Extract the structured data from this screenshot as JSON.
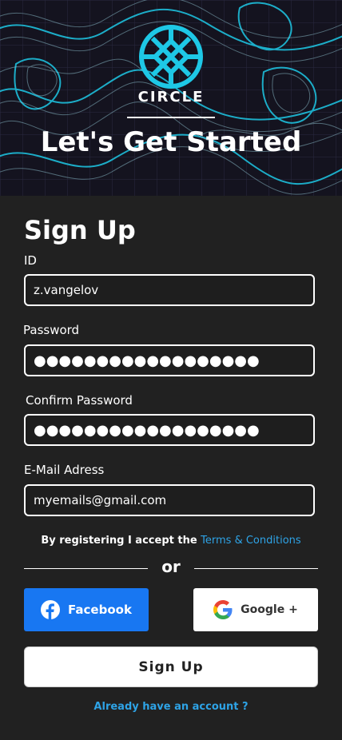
{
  "header": {
    "brand": "CIRCLE",
    "headline": "Let's Get Started"
  },
  "form": {
    "title": "Sign Up",
    "id_label": "ID",
    "id_value": "z.vangelov",
    "password_label": "Password",
    "password_value": "●●●●●●●●●●●●●●●●●●",
    "confirm_label": "Confirm Password",
    "confirm_value": "●●●●●●●●●●●●●●●●●●",
    "email_label": "E-Mail Adress",
    "email_value": "myemails@gmail.com"
  },
  "terms": {
    "prefix": "By registering I accept the ",
    "link": "Terms & Conditions"
  },
  "divider": {
    "text": "or"
  },
  "social": {
    "facebook_label": "Facebook",
    "google_label": "Google +"
  },
  "submit_label": "Sign Up",
  "login_link": "Already  have an account ?",
  "colors": {
    "background": "#212121",
    "accent": "#2ea3e6",
    "facebook": "#1877f2",
    "hero_lines": "#1ec8e6"
  },
  "icons": [
    "circle-knot-logo-icon",
    "facebook-icon",
    "google-icon"
  ]
}
